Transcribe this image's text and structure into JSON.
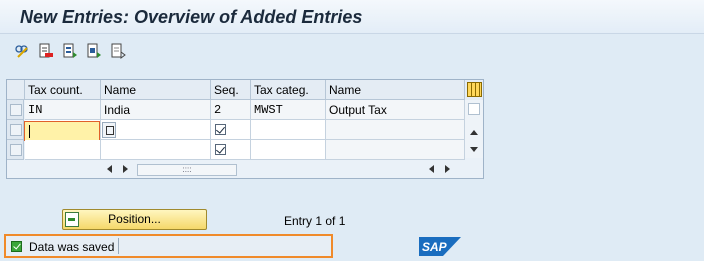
{
  "window": {
    "title": "New Entries: Overview of Added Entries"
  },
  "toolbar": {
    "buttons": [
      {
        "name": "display-change-icon"
      },
      {
        "name": "delete-entry-icon"
      },
      {
        "name": "select-all-icon"
      },
      {
        "name": "select-block-icon"
      },
      {
        "name": "deselect-all-icon"
      }
    ]
  },
  "table": {
    "columns": [
      "Tax count.",
      "Name",
      "Seq.",
      "Tax categ.",
      "Name"
    ],
    "rows": [
      {
        "tax_country": "IN",
        "name": "India",
        "seq": "2",
        "tax_categ": "MWST",
        "cat_name": "Output Tax",
        "check": false
      },
      {
        "tax_country": "",
        "name": "",
        "seq": "",
        "tax_categ": "",
        "cat_name": "",
        "check": true
      },
      {
        "tax_country": "",
        "name": "",
        "seq": "",
        "tax_categ": "",
        "cat_name": "",
        "check": true
      }
    ],
    "hscroll_thumb": "::::"
  },
  "footer": {
    "position_button": "Position...",
    "entry_info": "Entry 1 of 1"
  },
  "status": {
    "message": "Data was saved",
    "type": "success"
  },
  "branding": {
    "logo": "SAP"
  },
  "colors": {
    "accent_highlight": "#f08a2a",
    "input_active": "#fff2a8",
    "success": "#3aa53a",
    "sap_blue": "#1a6dbf"
  }
}
